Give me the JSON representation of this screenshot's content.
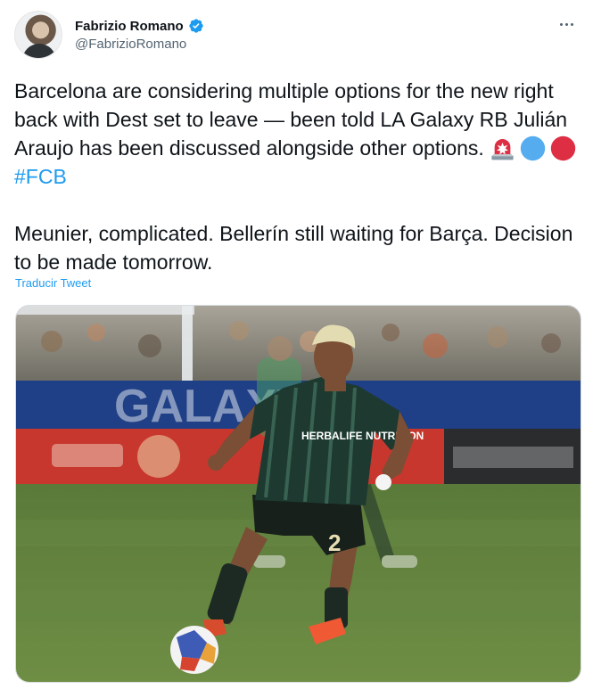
{
  "author": {
    "display_name": "Fabrizio Romano",
    "handle": "@FabrizioRomano",
    "verified": true
  },
  "tweet": {
    "paragraph1": "Barcelona are considering multiple options for the new right back with Dest set to leave — been told LA Galaxy RB Julián Araujo has been discussed alongside other options.",
    "emojis": [
      "rotating-light-emoji",
      "blue-circle-emoji",
      "red-circle-emoji"
    ],
    "hashtag": "#FCB",
    "paragraph2": "Meunier, complicated. Bellerín still waiting for Barça. Decision to be made tomorrow.",
    "translate_label": "Traducir Tweet"
  },
  "media": {
    "kit_sponsor": "HERBALIFE NUTRITION",
    "shirt_number": "2",
    "stadium_board": "GALAXY"
  },
  "colors": {
    "accent": "#1d9bf0",
    "text_primary": "#0f1419",
    "text_secondary": "#536471"
  }
}
